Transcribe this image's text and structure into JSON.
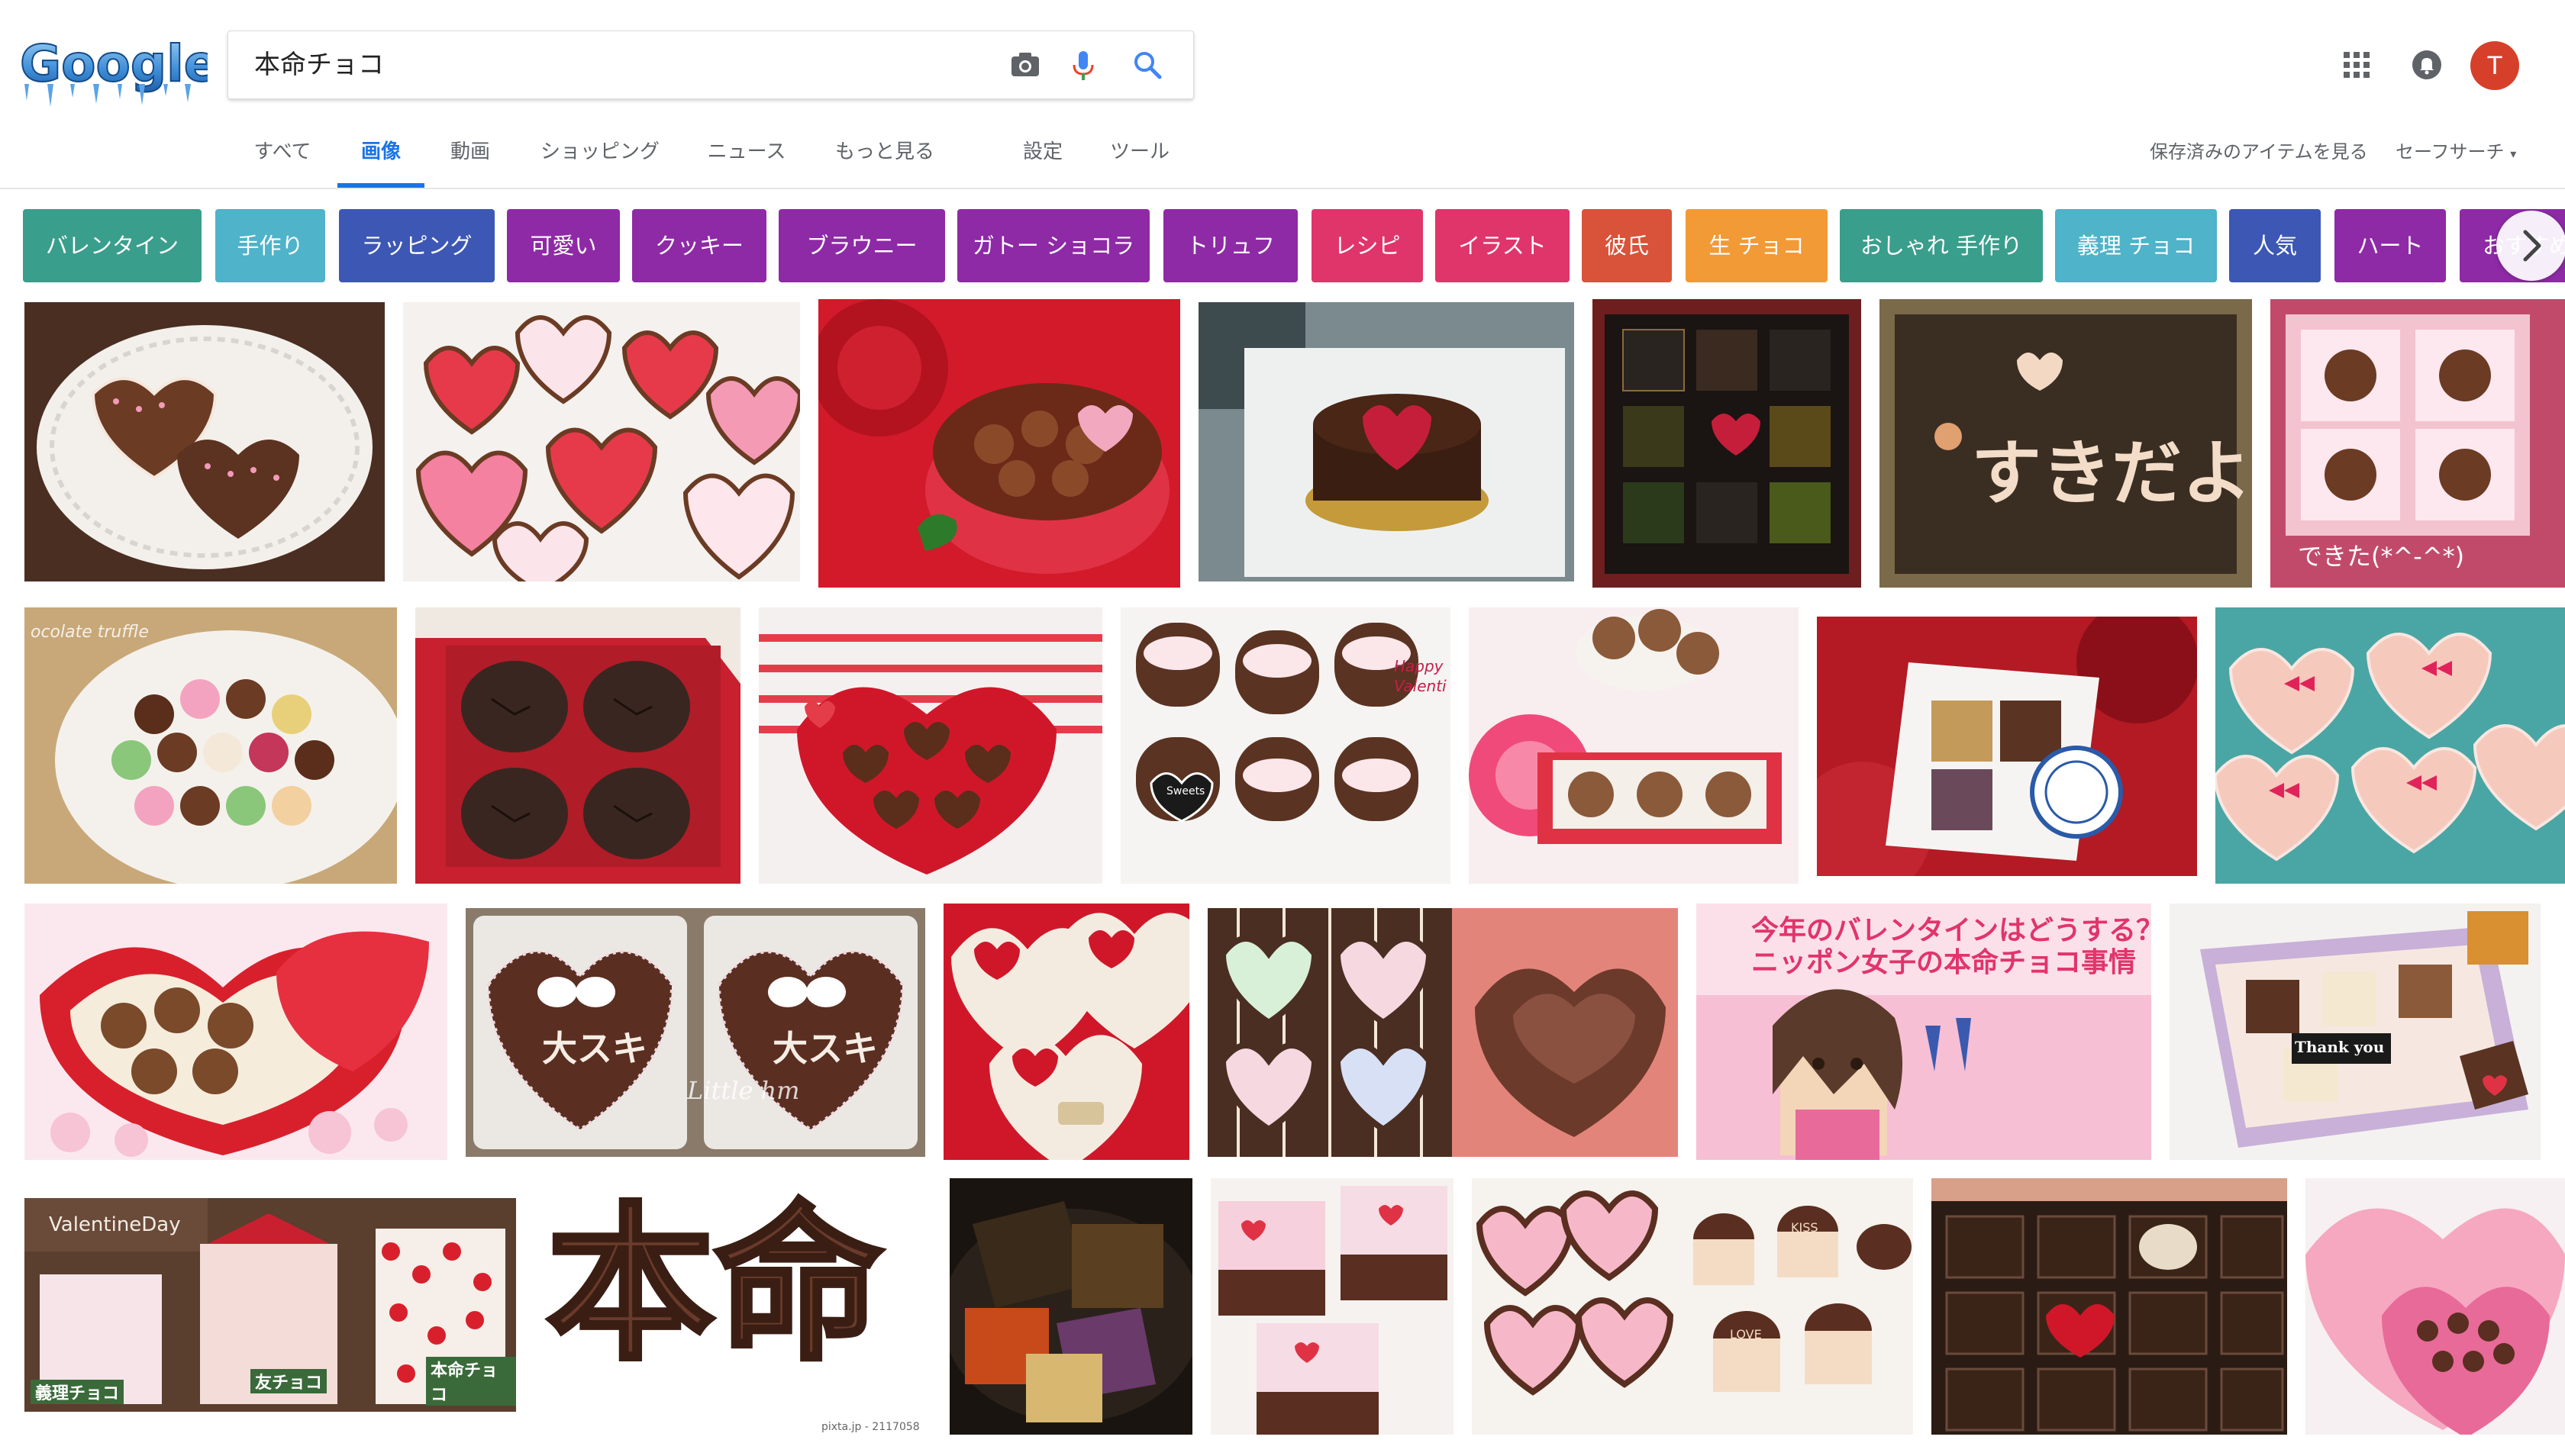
{
  "logo": {
    "text": "Google"
  },
  "search": {
    "query": "本命チョコ",
    "camera_icon": "camera-icon",
    "mic_icon": "microphone-icon",
    "search_icon": "search-icon"
  },
  "tabs": [
    {
      "label": "すべて",
      "active": false
    },
    {
      "label": "画像",
      "active": true
    },
    {
      "label": "動画",
      "active": false
    },
    {
      "label": "ショッピング",
      "active": false
    },
    {
      "label": "ニュース",
      "active": false
    },
    {
      "label": "もっと見る",
      "active": false
    },
    {
      "label": "設定",
      "active": false
    },
    {
      "label": "ツール",
      "active": false
    }
  ],
  "header_right": {
    "saved_items": "保存済みのアイテムを見る",
    "safe_search": "セーフサーチ",
    "avatar_letter": "T"
  },
  "chips": [
    {
      "label": "バレンタイン",
      "color": "#3a9e8c"
    },
    {
      "label": "手作り",
      "color": "#4fb3c9"
    },
    {
      "label": "ラッピング",
      "color": "#3d57b5"
    },
    {
      "label": "可愛い",
      "color": "#8e2aa6"
    },
    {
      "label": "クッキー",
      "color": "#8e2aa6"
    },
    {
      "label": "ブラウニー",
      "color": "#8e2aa6"
    },
    {
      "label": "ガトー ショコラ",
      "color": "#8e2aa6"
    },
    {
      "label": "トリュフ",
      "color": "#8e2aa6"
    },
    {
      "label": "レシピ",
      "color": "#e0356b"
    },
    {
      "label": "イラスト",
      "color": "#e0356b"
    },
    {
      "label": "彼氏",
      "color": "#d9533a"
    },
    {
      "label": "生 チョコ",
      "color": "#f29a36"
    },
    {
      "label": "おしゃれ 手作り",
      "color": "#3a9e8c"
    },
    {
      "label": "義理 チョコ",
      "color": "#4fb3c9"
    },
    {
      "label": "人気",
      "color": "#3d57b5"
    },
    {
      "label": "ハート",
      "color": "#8e2aa6"
    },
    {
      "label": "おすすめ",
      "color": "#8e2aa6"
    }
  ],
  "image_captions": {
    "dekita": "できた(*^-^*)",
    "chocolate_truffle": "ocolate truffle",
    "happy_valentine": "Happy Valenti",
    "article_title_1": "今年のバレンタインはどうする？",
    "article_title_2": "ニッポン女子の本命チョコ事情",
    "thank_you": "Thank you",
    "valentine_day": "ValentineDay",
    "giri_choco": "義理チョコ",
    "tomo_choco": "友チョコ",
    "honmei_choco": "本命チョコ",
    "honmei_big": "本命",
    "pixta_id": "pixta.jp - 2117058",
    "daisuki": "大スキ",
    "sweets": "Sweets",
    "little_hm": "Little hm",
    "kiss": "KISS",
    "love": "LOVE",
    "sukidayo": "すきだよ"
  },
  "colors": {
    "accent_blue": "#1a73e8",
    "tab_gray": "#5f6368",
    "avatar_red": "#d6402a"
  }
}
